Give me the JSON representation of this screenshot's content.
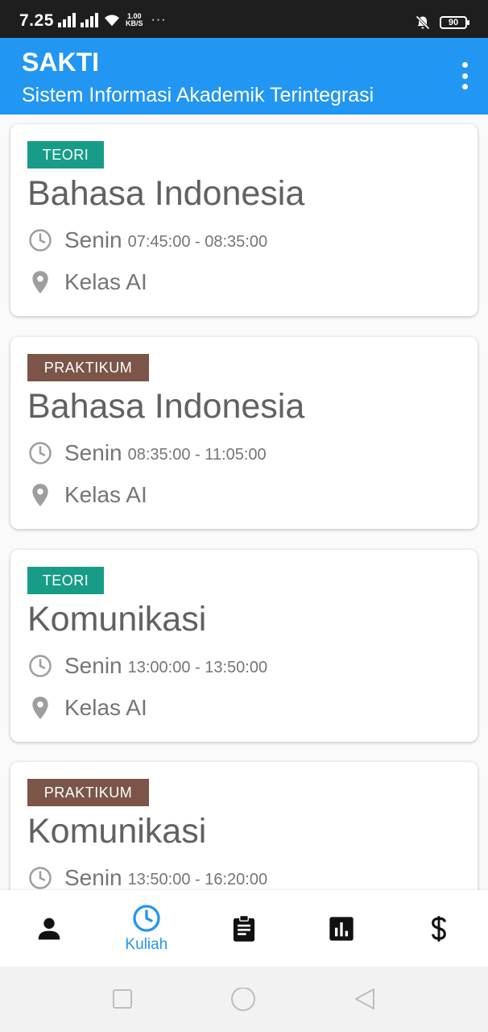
{
  "status_bar": {
    "time": "7.25",
    "net_speed_value": "1.00",
    "net_speed_unit": "KB/S",
    "more": "···",
    "battery": "90"
  },
  "app_bar": {
    "title": "SAKTI",
    "subtitle": "Sistem Informasi Akademik Terintegrasi",
    "menu_icon": "more-vert-icon"
  },
  "courses": [
    {
      "type": "TEORI",
      "name": "Bahasa Indonesia",
      "day": "Senin",
      "time": "07:45:00 - 08:35:00",
      "room": "Kelas AI"
    },
    {
      "type": "PRAKTIKUM",
      "name": "Bahasa Indonesia",
      "day": "Senin",
      "time": "08:35:00 - 11:05:00",
      "room": "Kelas AI"
    },
    {
      "type": "TEORI",
      "name": "Komunikasi",
      "day": "Senin",
      "time": "13:00:00 - 13:50:00",
      "room": "Kelas AI"
    },
    {
      "type": "PRAKTIKUM",
      "name": "Komunikasi",
      "day": "Senin",
      "time": "13:50:00 - 16:20:00",
      "room": ""
    }
  ],
  "bottom_nav": {
    "items": [
      {
        "icon": "person-icon",
        "label": ""
      },
      {
        "icon": "clock-icon",
        "label": "Kuliah",
        "active": true
      },
      {
        "icon": "assignment-icon",
        "label": ""
      },
      {
        "icon": "bar-chart-icon",
        "label": ""
      },
      {
        "icon": "dollar-icon",
        "label": ""
      }
    ]
  },
  "colors": {
    "primary": "#2196f3",
    "teori": "#179c87",
    "praktikum": "#7a5548",
    "text_muted": "#757575"
  }
}
